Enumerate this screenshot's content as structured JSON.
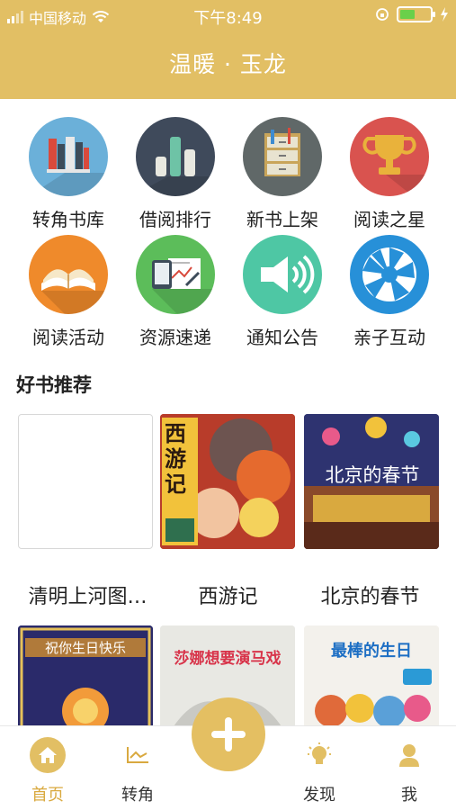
{
  "status_bar": {
    "carrier": "中国移动",
    "time": "下午8:49"
  },
  "header": {
    "title": "温暖 · 玉龙"
  },
  "grid": {
    "items": [
      {
        "label": "转角书库",
        "icon": "bookshelf-icon",
        "color": "#6bb0d9"
      },
      {
        "label": "借阅排行",
        "icon": "bar-chart-icon",
        "color": "#3f4a5b"
      },
      {
        "label": "新书上架",
        "icon": "file-cabinet-icon",
        "color": "#606868"
      },
      {
        "label": "阅读之星",
        "icon": "trophy-icon",
        "color": "#d9534f"
      },
      {
        "label": "阅读活动",
        "icon": "open-book-icon",
        "color": "#ef8a2b"
      },
      {
        "label": "资源速递",
        "icon": "tablet-document-icon",
        "color": "#5cbd5a"
      },
      {
        "label": "通知公告",
        "icon": "megaphone-icon",
        "color": "#4ec7a4"
      },
      {
        "label": "亲子互动",
        "icon": "aperture-icon",
        "color": "#2790d8"
      }
    ]
  },
  "recommend": {
    "title": "好书推荐",
    "books": [
      {
        "label": "清明上河图…",
        "cover_text": ""
      },
      {
        "label": "西游记",
        "cover_text": "西游记"
      },
      {
        "label": "北京的春节",
        "cover_text": "北京的春节"
      },
      {
        "label": "",
        "cover_text": "祝你生日快乐"
      },
      {
        "label": "",
        "cover_text": "莎娜想要演马戏"
      },
      {
        "label": "",
        "cover_text": "最棒的生日"
      }
    ]
  },
  "tabbar": {
    "tabs": [
      {
        "label": "首页",
        "icon": "home-icon",
        "active": true
      },
      {
        "label": "转角",
        "icon": "trend-icon",
        "active": false
      },
      {
        "label": "发现",
        "icon": "lightbulb-icon",
        "active": false
      },
      {
        "label": "我",
        "icon": "user-icon",
        "active": false
      }
    ],
    "fab_icon": "plus-icon"
  },
  "colors": {
    "accent": "#e2bf64",
    "active_tab": "#d9a93f"
  }
}
